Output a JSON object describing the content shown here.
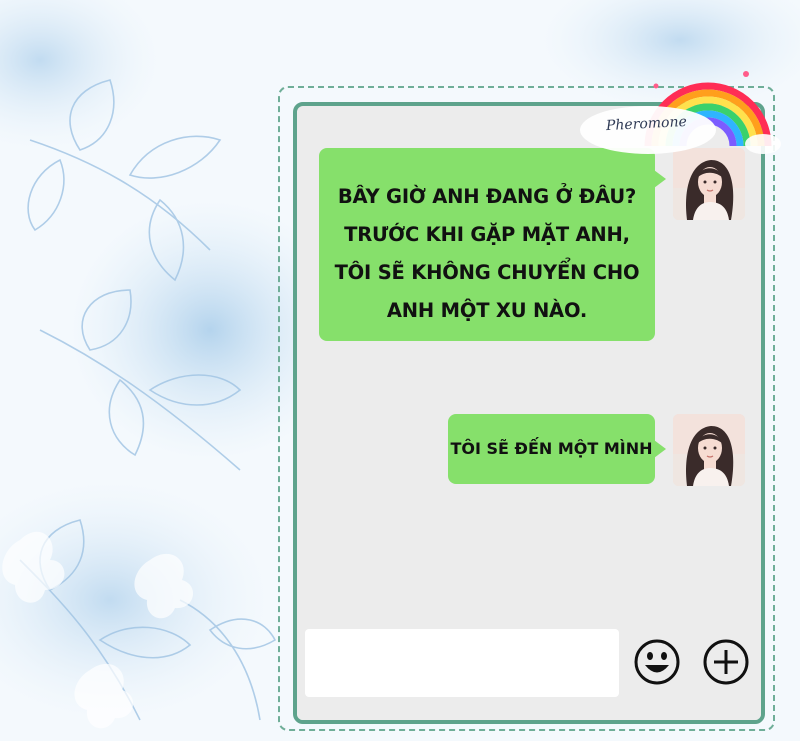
{
  "chat": {
    "messages": [
      {
        "sender": "self",
        "lines": [
          "BÂY GIỜ ANH ĐANG Ở ĐÂU?",
          "TRƯỚC KHI GẶP MẶT ANH,",
          "TÔI SẼ KHÔNG CHUYỂN CHO",
          "ANH MỘT XU NÀO."
        ]
      },
      {
        "sender": "self",
        "lines": [
          "TÔI SẼ ĐẾN MỘT MÌNH"
        ]
      }
    ]
  },
  "input_bar": {
    "text_value": "",
    "emoji_icon": "smiley-face-icon",
    "add_icon": "plus-circle-icon"
  },
  "watermark": {
    "text": "Pheromone"
  },
  "colors": {
    "bubble": "#86e06b",
    "frame": "#5ea38c",
    "chat_background": "#ececec",
    "page_background": "#f4f9fd"
  }
}
